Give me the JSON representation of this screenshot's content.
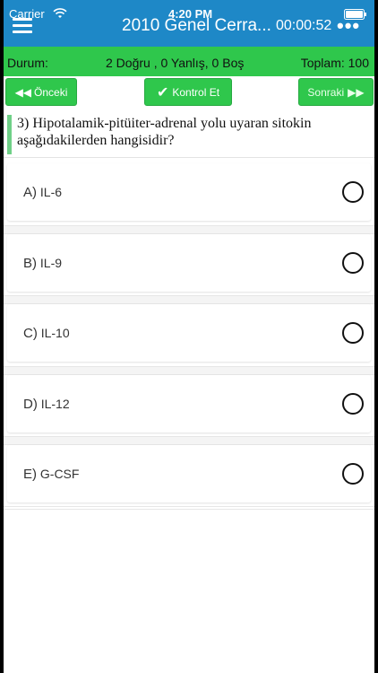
{
  "status_bar": {
    "carrier": "Carrier",
    "time": "4:20 PM"
  },
  "header": {
    "title": "2010 Genel Cerra...",
    "timer": "00:00:52",
    "more": "•••"
  },
  "summary": {
    "label": "Durum:",
    "counts": "2 Doğru , 0 Yanlış, 0 Boş",
    "total": "Toplam: 100"
  },
  "nav": {
    "prev_label": "Önceki",
    "check_label": "Kontrol Et",
    "next_label": "Sonraki"
  },
  "question": {
    "text": "3) Hipotalamik-pitüiter-adrenal yolu uyaran sitokin aşağıdakilerden hangisidir?"
  },
  "options": [
    {
      "letter": "A)",
      "text": "IL-6"
    },
    {
      "letter": "B)",
      "text": "IL-9"
    },
    {
      "letter": "C)",
      "text": "IL-10"
    },
    {
      "letter": "D)",
      "text": "IL-12"
    },
    {
      "letter": "E)",
      "text": "G-CSF"
    }
  ],
  "colors": {
    "header_blue": "#1e88c7",
    "accent_green": "#2fc74c",
    "question_bar": "#6fd087"
  },
  "icons": {
    "menu": "hamburger-menu-icon",
    "more": "more-dots-icon",
    "prev": "double-left-arrow-icon",
    "check": "checkmark-icon",
    "next": "double-right-arrow-icon",
    "radio": "radio-circle-icon"
  }
}
